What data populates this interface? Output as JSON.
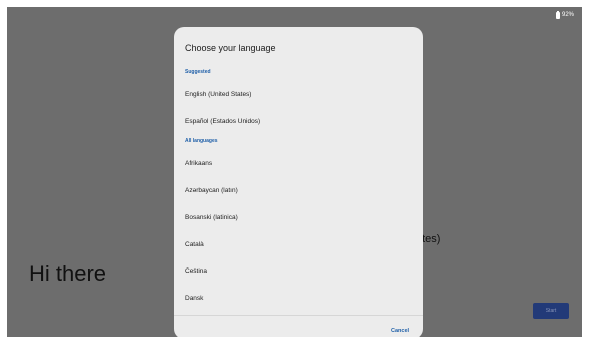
{
  "status_bar": {
    "battery_icon": "battery-icon",
    "battery_level": "92%"
  },
  "background": {
    "greeting": "Hi there",
    "language_peek": "ates)",
    "start_label": "Start"
  },
  "dialog": {
    "title": "Choose your language",
    "suggested_header": "Suggested",
    "suggested": [
      "English (United States)",
      "Español (Estados Unidos)"
    ],
    "all_header": "All languages",
    "all_languages": [
      "Afrikaans",
      "Azərbaycan (latın)",
      "Bosanski (latinica)",
      "Català",
      "Čeština",
      "Dansk"
    ],
    "cancel_label": "Cancel"
  },
  "colors": {
    "accent": "#1f5fa8",
    "dim_overlay": "#6d6d6d",
    "dialog_bg": "#ececec",
    "start_button": "#223a78"
  }
}
